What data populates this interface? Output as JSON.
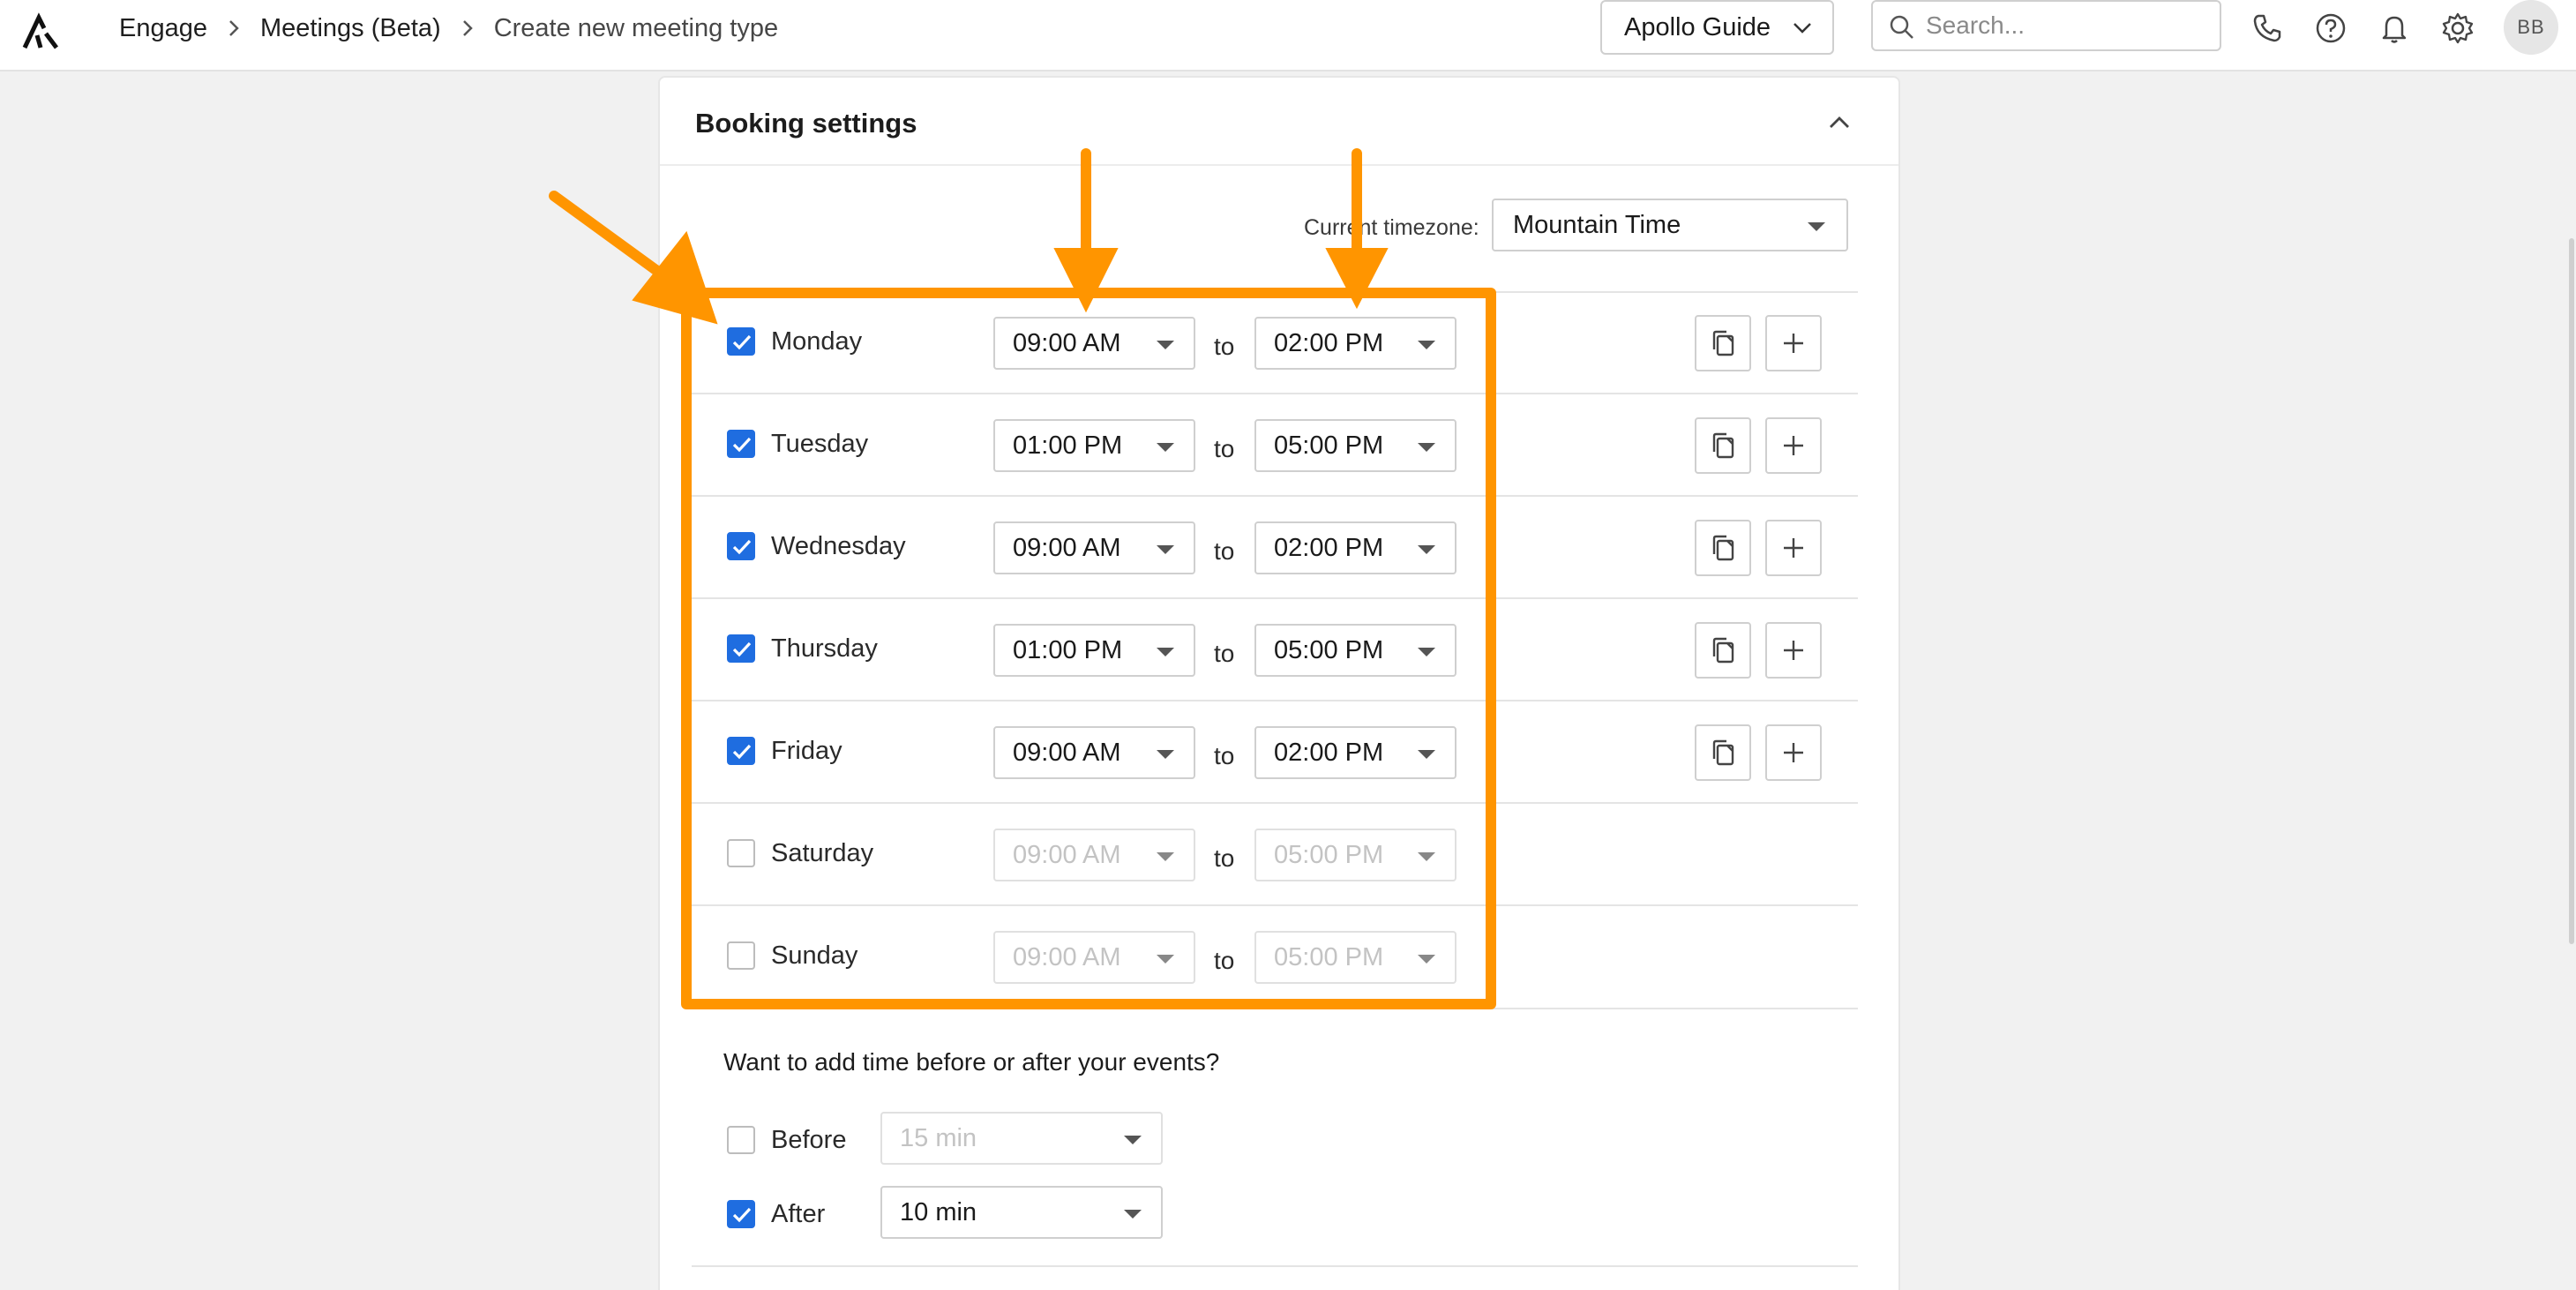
{
  "breadcrumb": {
    "items": [
      "Engage",
      "Meetings (Beta)",
      "Create new meeting type"
    ]
  },
  "header": {
    "guide_label": "Apollo Guide",
    "search_placeholder": "Search...",
    "avatar_initials": "BB"
  },
  "booking": {
    "title": "Booking settings",
    "timezone_label": "Current timezone:",
    "timezone_value": "Mountain Time",
    "to_label": "to",
    "days": [
      {
        "label": "Monday",
        "checked": true,
        "start": "09:00 AM",
        "end": "02:00 PM"
      },
      {
        "label": "Tuesday",
        "checked": true,
        "start": "01:00 PM",
        "end": "05:00 PM"
      },
      {
        "label": "Wednesday",
        "checked": true,
        "start": "09:00 AM",
        "end": "02:00 PM"
      },
      {
        "label": "Thursday",
        "checked": true,
        "start": "01:00 PM",
        "end": "05:00 PM"
      },
      {
        "label": "Friday",
        "checked": true,
        "start": "09:00 AM",
        "end": "02:00 PM"
      },
      {
        "label": "Saturday",
        "checked": false,
        "start": "09:00 AM",
        "end": "05:00 PM"
      },
      {
        "label": "Sunday",
        "checked": false,
        "start": "09:00 AM",
        "end": "05:00 PM"
      }
    ],
    "buffer_question": "Want to add time before or after your events?",
    "buffers": [
      {
        "label": "Before",
        "checked": false,
        "value": "15 min"
      },
      {
        "label": "After",
        "checked": true,
        "value": "10 min"
      }
    ]
  },
  "colors": {
    "accent": "#1f6de0",
    "annotation": "#ff9500"
  },
  "icons": [
    "apollo-logo-icon",
    "chevron-right-icon",
    "chevron-down-icon",
    "search-icon",
    "phone-icon",
    "help-icon",
    "bell-icon",
    "gear-icon",
    "chevron-up-icon",
    "copy-icon",
    "plus-icon",
    "checkmark-icon"
  ]
}
